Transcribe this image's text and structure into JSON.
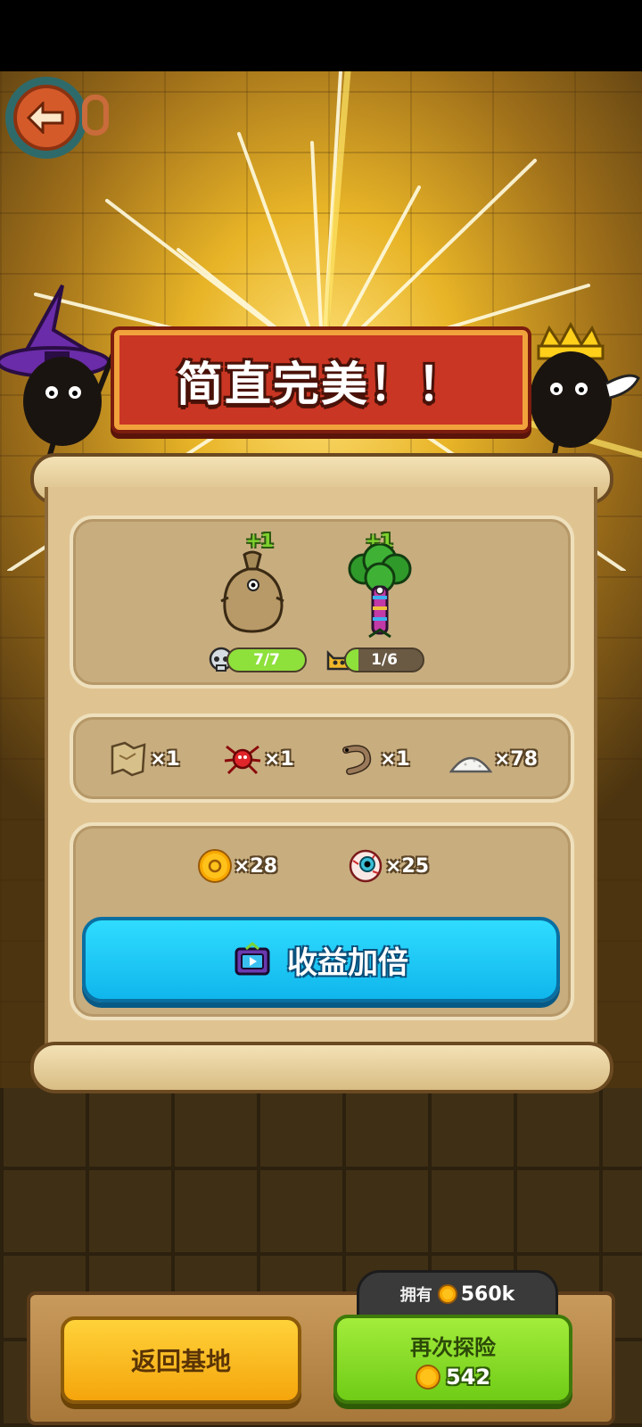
{
  "header": {
    "title": "简直完美！！"
  },
  "pets": [
    {
      "name_icon": "sack-creature-icon",
      "plus": "+1",
      "badge_icon": "skull-badge-icon",
      "progress_text": "7/7",
      "progress": 1.0,
      "color": "#8ee03a"
    },
    {
      "name_icon": "broccoli-creature-icon",
      "plus": "+1",
      "badge_icon": "cat-badge-icon",
      "progress_text": "1/6",
      "progress": 0.1667,
      "color": "#8ee03a"
    }
  ],
  "items": [
    {
      "icon": "map-scroll-icon",
      "count": "×1"
    },
    {
      "icon": "red-spider-icon",
      "count": "×1"
    },
    {
      "icon": "worm-icon",
      "count": "×1"
    },
    {
      "icon": "salt-pile-icon",
      "count": "×78"
    }
  ],
  "rewards": [
    {
      "icon": "gold-coin-icon",
      "count": "×28"
    },
    {
      "icon": "eyeball-icon",
      "count": "×25"
    }
  ],
  "double_button": {
    "icon": "tv-ad-icon",
    "label": "收益加倍"
  },
  "footer": {
    "own_label": "拥有",
    "own_value": "560k",
    "return_label": "返回基地",
    "again_label": "再次探险",
    "again_cost": "542"
  },
  "colors": {
    "accent_blue": "#10b6ec",
    "accent_green": "#6fcc16",
    "accent_yellow": "#f5a50c",
    "banner_red": "#c93623"
  }
}
